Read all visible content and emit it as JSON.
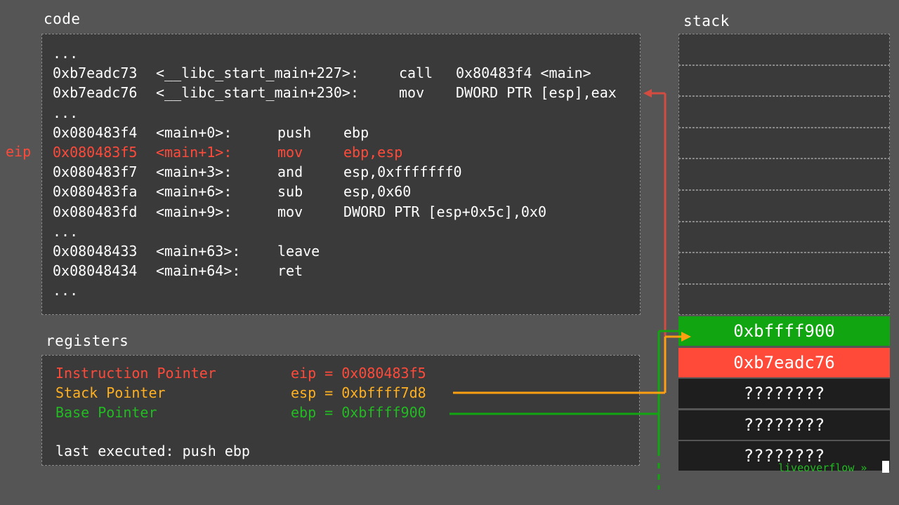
{
  "labels": {
    "code": "code",
    "registers": "registers",
    "stack": "stack"
  },
  "code": {
    "lines": [
      {
        "addr": "...",
        "sym": "",
        "op": "",
        "args": ""
      },
      {
        "addr": "0xb7eadc73",
        "sym": "<__libc_start_main+227>:",
        "op": "call",
        "args": "0x80483f4 <main>"
      },
      {
        "addr": "0xb7eadc76",
        "sym": "<__libc_start_main+230>:",
        "op": "mov",
        "args": "DWORD PTR [esp],eax"
      },
      {
        "addr": "...",
        "sym": "",
        "op": "",
        "args": ""
      },
      {
        "addr": "0x080483f4",
        "sym": "<main+0>:",
        "op": "push",
        "args": "ebp"
      },
      {
        "addr": "0x080483f5",
        "sym": "<main+1>:",
        "op": "mov",
        "args": "ebp,esp"
      },
      {
        "addr": "0x080483f7",
        "sym": "<main+3>:",
        "op": "and",
        "args": "esp,0xfffffff0"
      },
      {
        "addr": "0x080483fa",
        "sym": "<main+6>:",
        "op": "sub",
        "args": "esp,0x60"
      },
      {
        "addr": "0x080483fd",
        "sym": "<main+9>:",
        "op": "mov",
        "args": "DWORD PTR [esp+0x5c],0x0"
      },
      {
        "addr": "...",
        "sym": "",
        "op": "",
        "args": ""
      },
      {
        "addr": "0x08048433",
        "sym": "<main+63>:",
        "op": "leave",
        "args": ""
      },
      {
        "addr": "0x08048434",
        "sym": "<main+64>:",
        "op": "ret",
        "args": ""
      },
      {
        "addr": "...",
        "sym": "",
        "op": "",
        "args": ""
      }
    ],
    "current_index": 5,
    "eip_marker": "eip"
  },
  "registers": {
    "ip": {
      "name": "Instruction Pointer",
      "value": "eip = 0x080483f5",
      "color": "#ff4a3a"
    },
    "sp": {
      "name": "Stack Pointer",
      "value": "esp = 0xbffff7d8",
      "color": "#ffb020"
    },
    "bp": {
      "name": "Base Pointer",
      "value": "ebp = 0xbffff900",
      "color": "#22bb22"
    },
    "last_executed": "last executed: push ebp"
  },
  "stack": {
    "empty_slots": 9,
    "filled": [
      {
        "value": "0xbffff900",
        "style": "green"
      },
      {
        "value": "0xb7eadc76",
        "style": "red"
      },
      {
        "value": "????????",
        "style": "dark"
      },
      {
        "value": "????????",
        "style": "dark"
      },
      {
        "value": "????????",
        "style": "dark"
      }
    ]
  },
  "watermark": "liveoverflow »"
}
